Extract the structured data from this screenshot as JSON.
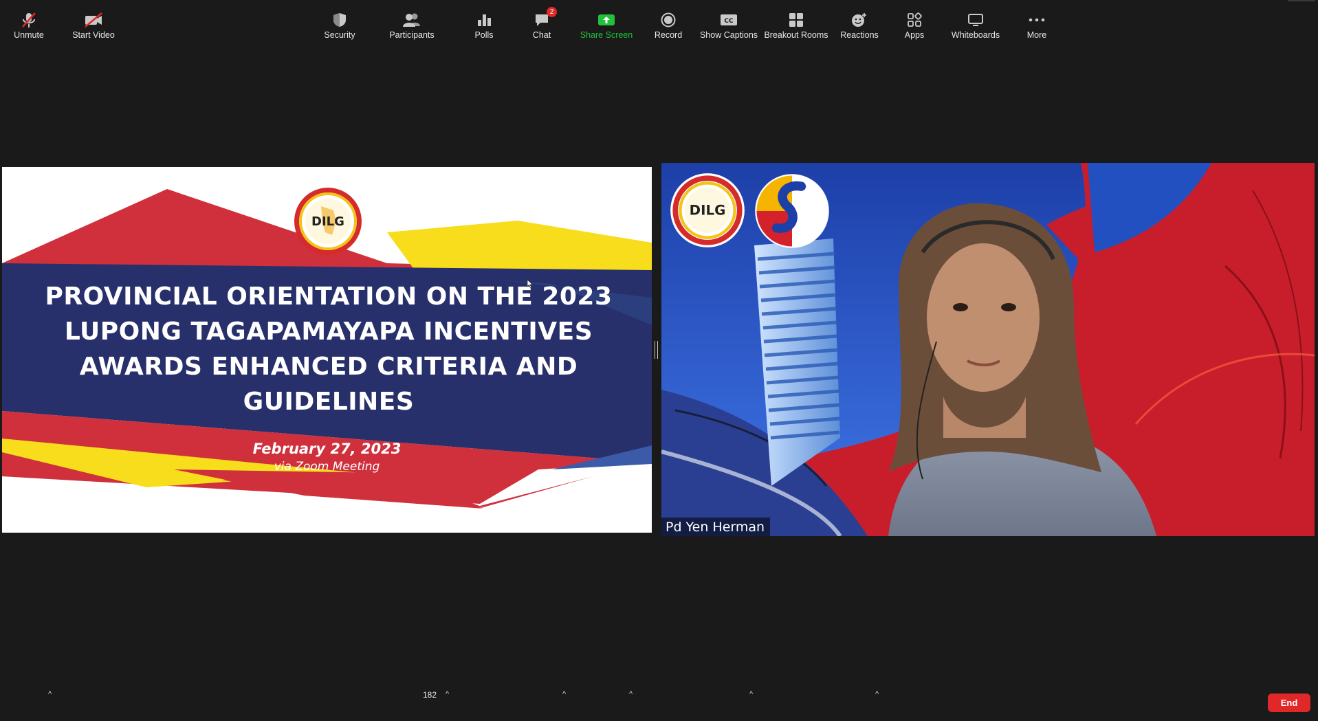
{
  "slide": {
    "logo_text": "DILG",
    "title": "PROVINCIAL ORIENTATION ON THE 2023 LUPONG TAGAPAMAYAPA INCENTIVES AWARDS ENHANCED CRITERIA AND GUIDELINES",
    "date": "February 27, 2023",
    "subtitle": "via Zoom Meeting"
  },
  "video": {
    "participant_name": "Pd Yen Herman",
    "logo_text": "DILG"
  },
  "toolbar": {
    "unmute": "Unmute",
    "start_video": "Start Video",
    "security": "Security",
    "participants": "Participants",
    "participants_count": "182",
    "polls": "Polls",
    "chat": "Chat",
    "chat_badge": "2",
    "share_screen": "Share Screen",
    "record": "Record",
    "show_captions": "Show Captions",
    "captions_icon_text": "CC",
    "breakout_rooms": "Breakout Rooms",
    "reactions": "Reactions",
    "apps": "Apps",
    "whiteboards": "Whiteboards",
    "more": "More",
    "end": "End"
  },
  "colors": {
    "background": "#1a1a1a",
    "slide_navy": "#27306b",
    "slide_red": "#d0303c",
    "slide_yellow": "#f7dd1c",
    "share_green": "#21c13b",
    "end_red": "#e02828"
  }
}
